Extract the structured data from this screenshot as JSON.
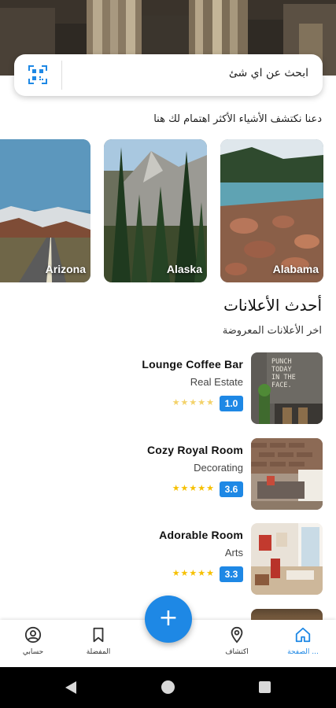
{
  "search": {
    "placeholder": "ابحث عن اي شئ"
  },
  "discover_heading": "دعنا نكتشف الأشياء الأكثر اهتمام لك هنا",
  "places": [
    {
      "name": "Alabama"
    },
    {
      "name": "Alaska"
    },
    {
      "name": "Arizona"
    }
  ],
  "latest": {
    "title": "أحدث الأعلانات",
    "subtitle": "اخر الأعلانات المعروضة"
  },
  "listings": [
    {
      "title": "Lounge Coffee Bar",
      "category": "Real Estate",
      "rating": "1.0",
      "stars": "★★★★★"
    },
    {
      "title": "Cozy Royal Room",
      "category": "Decorating",
      "rating": "3.6",
      "stars": "★★★★★"
    },
    {
      "title": "Adorable Room",
      "category": "Arts",
      "rating": "3.3",
      "stars": "★★★★★"
    }
  ],
  "thumb_text": "PUNCH TODAY IN THE FACE.",
  "fab_label": "+",
  "nav": {
    "home": "الصفحة ...",
    "explore": "اكتشاف",
    "bookmarks": "المفضلة",
    "account": "حسابي"
  },
  "colors": {
    "accent": "#1e88e5",
    "star": "#f6c000"
  }
}
